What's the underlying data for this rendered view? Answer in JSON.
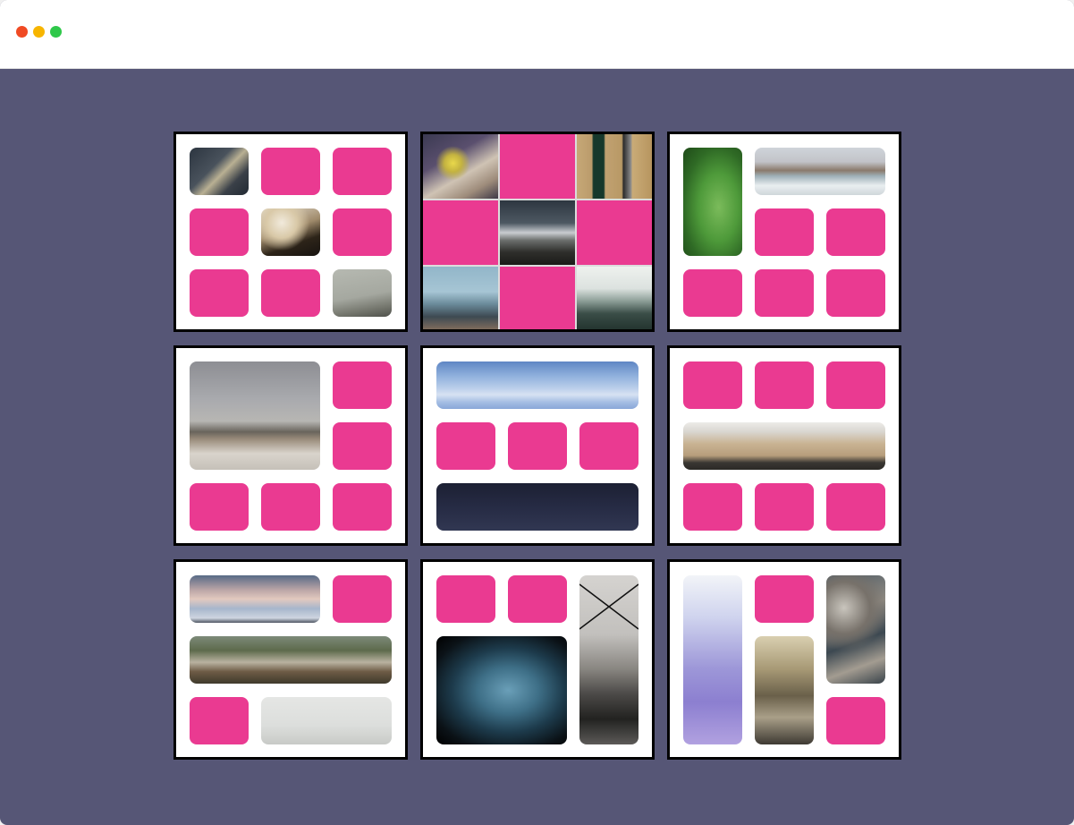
{
  "window": {
    "controls": [
      {
        "name": "close-button",
        "color": "#f04a23"
      },
      {
        "name": "minimize-button",
        "color": "#f7b500"
      },
      {
        "name": "maximize-button",
        "color": "#2fc84a"
      }
    ]
  },
  "colors": {
    "background": "#565676",
    "tile_accent": "#ea3a91",
    "card_border": "#000000",
    "card_background": "#ffffff"
  },
  "gallery": {
    "cards": [
      {
        "tiles": [
          "photo-stairs",
          "pink",
          "pink",
          "pink",
          "photo-cliff",
          "pink",
          "pink",
          "pink",
          "photo-fog-cliff"
        ]
      },
      {
        "tiles": [
          "photo-flower",
          "pink",
          "photo-door",
          "pink",
          "photo-mountain",
          "pink",
          "photo-statue-of-liberty",
          "pink",
          "photo-forest"
        ]
      },
      {
        "tiles": [
          "photo-leaf",
          "photo-golden-gate-bridge",
          "pink",
          "pink",
          "pink",
          "pink",
          "pink"
        ]
      },
      {
        "tiles": [
          "photo-beach",
          "pink",
          "pink",
          "pink",
          "pink",
          "pink"
        ]
      },
      {
        "tiles": [
          "photo-blue-mountains",
          "pink",
          "pink",
          "pink",
          "photo-night-sky"
        ]
      },
      {
        "tiles": [
          "pink",
          "pink",
          "pink",
          "photo-sand-rocks",
          "pink",
          "pink",
          "pink"
        ]
      },
      {
        "tiles": [
          "photo-snow-peak",
          "pink",
          "photo-forest-road",
          "pink",
          "photo-fog"
        ]
      },
      {
        "tiles": [
          "pink",
          "pink",
          "photo-city",
          "photo-phone",
          "photo-turn-to-clear"
        ]
      },
      {
        "tiles": [
          "photo-sea-bridge",
          "pink",
          "photo-water",
          "photo-canal",
          "pink"
        ]
      }
    ]
  }
}
